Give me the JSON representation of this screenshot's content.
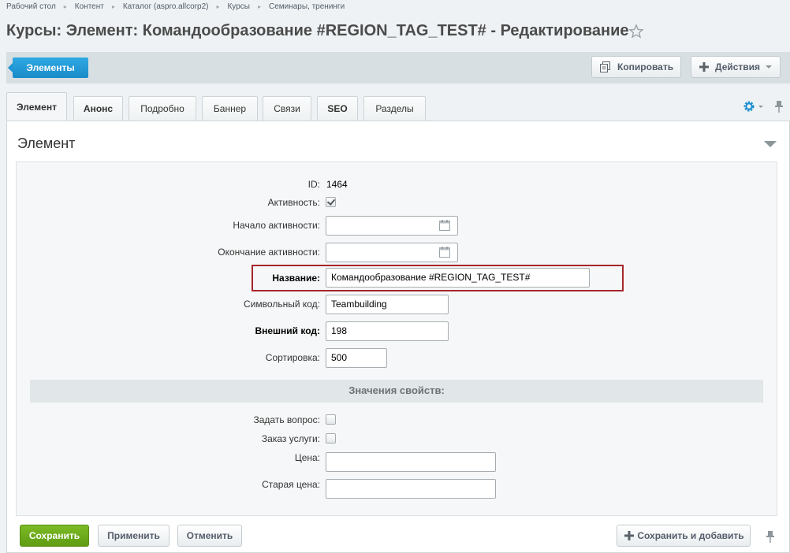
{
  "breadcrumbs": [
    "Рабочий стол",
    "Контент",
    "Каталог (aspro.allcorp2)",
    "Курсы",
    "Семинары, тренинги"
  ],
  "page_title": "Курсы: Элемент: Командообразование #REGION_TAG_TEST# - Редактирование",
  "toolbar": {
    "elements_label": "Элементы",
    "copy_label": "Копировать",
    "actions_label": "Действия"
  },
  "tabs": [
    {
      "label": "Элемент",
      "active": true
    },
    {
      "label": "Анонс"
    },
    {
      "label": "Подробно"
    },
    {
      "label": "Баннер"
    },
    {
      "label": "Связи"
    },
    {
      "label": "SEO"
    },
    {
      "label": "Разделы"
    }
  ],
  "section": {
    "title": "Элемент"
  },
  "form": {
    "id": {
      "label": "ID:",
      "value": "1464"
    },
    "active": {
      "label": "Активность:",
      "checked": true
    },
    "active_from": {
      "label": "Начало активности:",
      "value": ""
    },
    "active_to": {
      "label": "Окончание активности:",
      "value": ""
    },
    "name": {
      "label": "Название:",
      "value": "Командообразование #REGION_TAG_TEST#"
    },
    "code": {
      "label": "Символьный код:",
      "value": "Teambuilding"
    },
    "xml_id": {
      "label": "Внешний код:",
      "value": "198"
    },
    "sort": {
      "label": "Сортировка:",
      "value": "500"
    }
  },
  "properties": {
    "header": "Значения свойств:",
    "ask_question": {
      "label": "Задать вопрос:",
      "checked": false
    },
    "order_service": {
      "label": "Заказ услуги:",
      "checked": false
    },
    "price": {
      "label": "Цена:",
      "value": ""
    },
    "old_price": {
      "label": "Старая цена:",
      "value": ""
    }
  },
  "buttons": {
    "save": "Сохранить",
    "apply": "Применить",
    "cancel": "Отменить",
    "save_add": "Сохранить и добавить"
  },
  "colors": {
    "accent_blue": "#1e96d6",
    "save_green": "#6aab1b",
    "highlight_red": "#a6272b"
  }
}
